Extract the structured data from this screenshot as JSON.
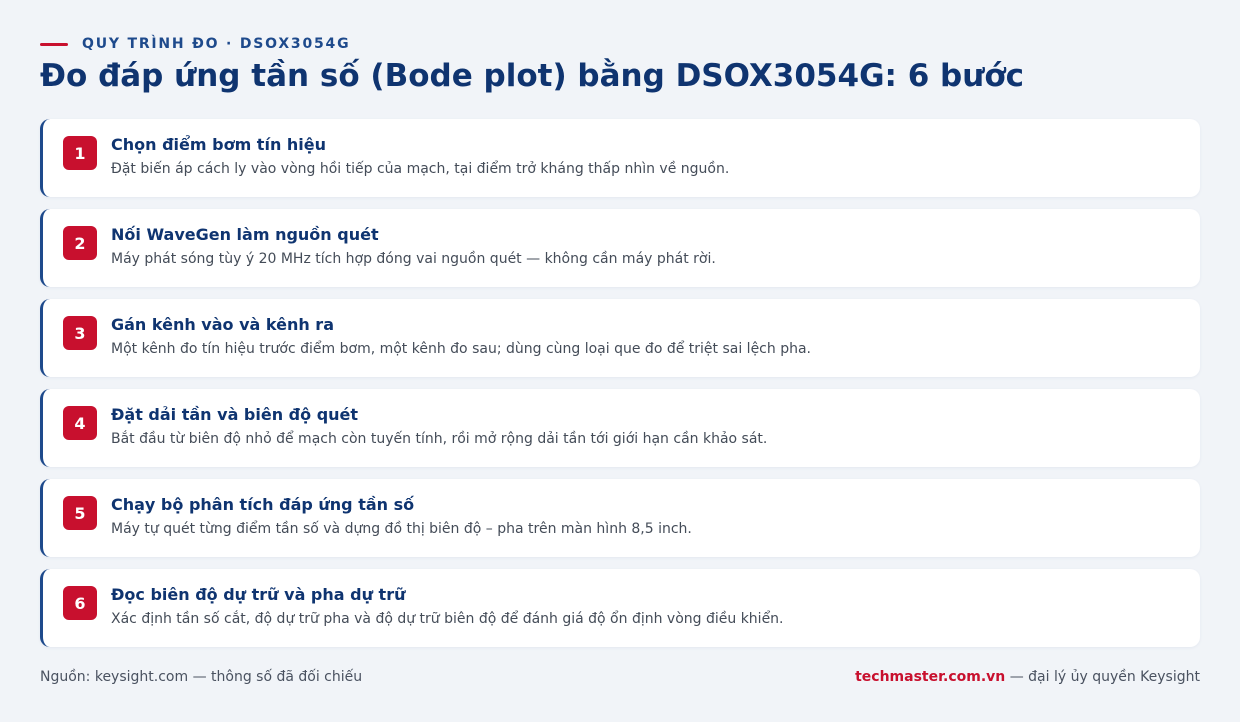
{
  "header": {
    "eyebrow": "QUY TRÌNH ĐO · DSOX3054G",
    "title": "Đo đáp ứng tần số (Bode plot) bằng DSOX3054G: 6 bước"
  },
  "steps": [
    {
      "number": "1",
      "title": "Chọn điểm bơm tín hiệu",
      "desc": "Đặt biến áp cách ly vào vòng hồi tiếp của mạch, tại điểm trở kháng thấp nhìn về nguồn."
    },
    {
      "number": "2",
      "title": "Nối WaveGen làm nguồn quét",
      "desc": "Máy phát sóng tùy ý 20 MHz tích hợp đóng vai nguồn quét — không cần máy phát rời."
    },
    {
      "number": "3",
      "title": "Gán kênh vào và kênh ra",
      "desc": "Một kênh đo tín hiệu trước điểm bơm, một kênh đo sau; dùng cùng loại que đo để triệt sai lệch pha."
    },
    {
      "number": "4",
      "title": "Đặt dải tần và biên độ quét",
      "desc": "Bắt đầu từ biên độ nhỏ để mạch còn tuyến tính, rồi mở rộng dải tần tới giới hạn cần khảo sát."
    },
    {
      "number": "5",
      "title": "Chạy bộ phân tích đáp ứng tần số",
      "desc": "Máy tự quét từng điểm tần số và dựng đồ thị biên độ – pha trên màn hình 8,5 inch."
    },
    {
      "number": "6",
      "title": "Đọc biên độ dự trữ và pha dự trữ",
      "desc": "Xác định tần số cắt, độ dự trữ pha và độ dự trữ biên độ để đánh giá độ ổn định vòng điều khiển."
    }
  ],
  "footer": {
    "source": "Nguồn: keysight.com — thông số đã đối chiếu",
    "brand": "techmaster.com.vn",
    "brand_suffix": " — đại lý ủy quyền Keysight"
  },
  "colors": {
    "accent": "#c8102e",
    "primary": "#0f3470",
    "background": "#f1f4f8"
  }
}
